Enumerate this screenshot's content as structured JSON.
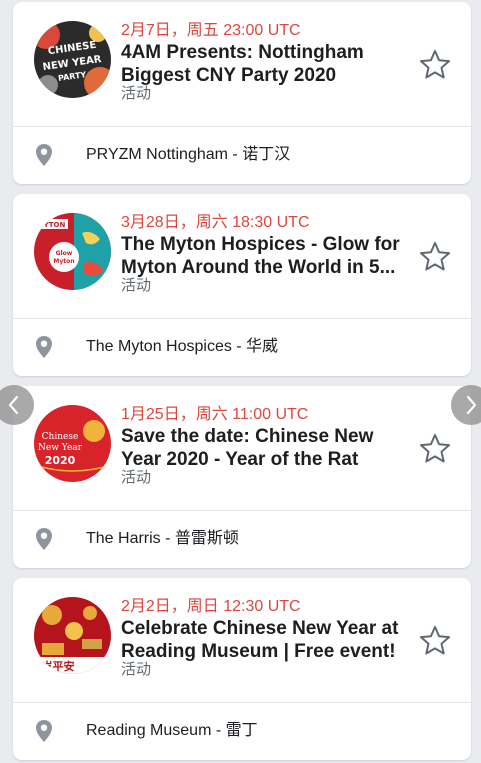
{
  "events": [
    {
      "date": "2月7日，周五 23:00 UTC",
      "title": "4AM Presents: Nottingham Biggest CNY Party 2020",
      "category": "活动",
      "location": "PRYZM Nottingham - 诺丁汉",
      "thumb_text": [
        "CHINESE",
        "NEW YEAR",
        "PARTY"
      ]
    },
    {
      "date": "3月28日，周六 18:30 UTC",
      "title": "The Myton Hospices - Glow for Myton Around the World in 5...",
      "category": "活动",
      "location": "The Myton Hospices - 华威",
      "thumb_text": [
        "MYTON",
        "Glow",
        "Myton"
      ]
    },
    {
      "date": "1月25日，周六 11:00 UTC",
      "title": "Save the date: Chinese New Year 2020 - Year of the Rat",
      "category": "活动",
      "location": "The Harris - 普雷斯顿",
      "thumb_text": [
        "Chinese",
        "New Year",
        "2020"
      ]
    },
    {
      "date": "2月2日，周日 12:30 UTC",
      "title": "Celebrate Chinese New Year at Reading Museum | Free event!",
      "category": "活动",
      "location": "Reading Museum - 雷丁",
      "thumb_text": [
        "岁平安"
      ]
    }
  ],
  "colors": {
    "date_red": "#e0453f",
    "background": "#e9ebee",
    "text_primary": "#1c1e21",
    "text_secondary": "#606770"
  },
  "icons": {
    "interested": "star-outline-icon",
    "location": "location-pin-icon",
    "prev": "chevron-left-icon",
    "next": "chevron-right-icon"
  }
}
